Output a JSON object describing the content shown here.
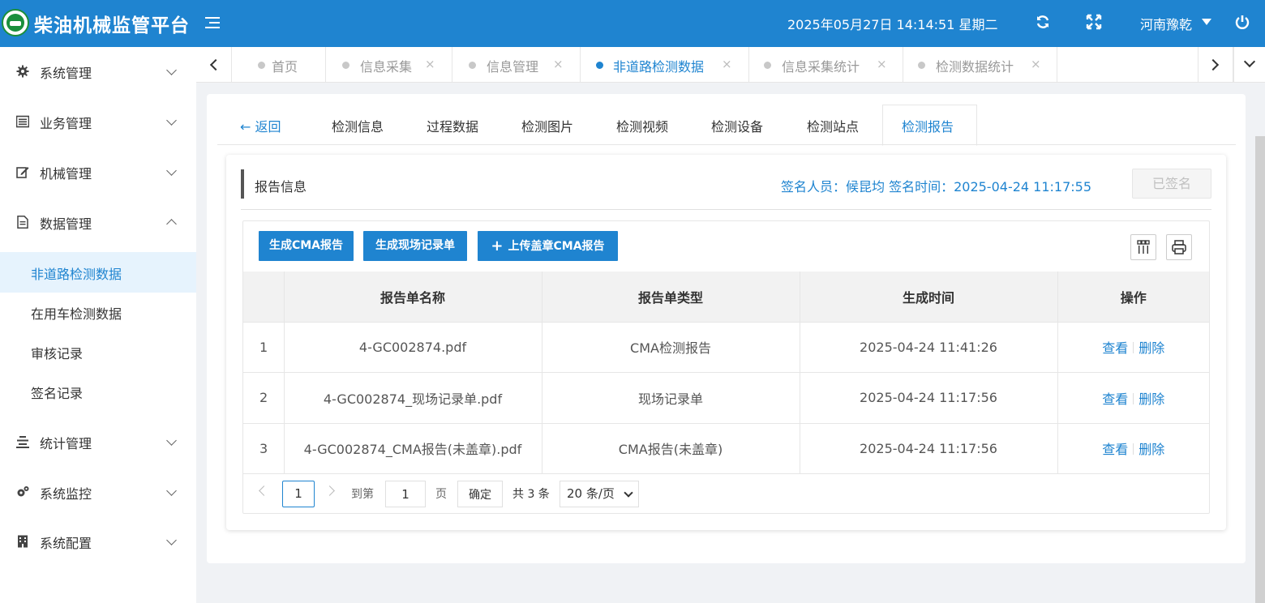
{
  "header": {
    "title": "柴油机械监管平台",
    "datetime": "2025年05月27日 14:14:51 星期二",
    "user": "河南豫乾"
  },
  "sidebar": {
    "menus": [
      {
        "label": "系统管理",
        "icon": "gear-icon"
      },
      {
        "label": "业务管理",
        "icon": "list-icon"
      },
      {
        "label": "机械管理",
        "icon": "edit-icon"
      },
      {
        "label": "数据管理",
        "icon": "document-icon"
      },
      {
        "label": "统计管理",
        "icon": "bars-icon"
      },
      {
        "label": "系统监控",
        "icon": "gears-icon"
      },
      {
        "label": "系统配置",
        "icon": "building-icon"
      }
    ],
    "data_submenu": [
      "非道路检测数据",
      "在用车检测数据",
      "审核记录",
      "签名记录"
    ]
  },
  "tabs": [
    "首页",
    "信息采集",
    "信息管理",
    "非道路检测数据",
    "信息采集统计",
    "检测数据统计"
  ],
  "subtabs": {
    "back": "← 返回",
    "items": [
      "检测信息",
      "过程数据",
      "检测图片",
      "检测视频",
      "检测设备",
      "检测站点",
      "检测报告"
    ]
  },
  "report": {
    "section_title": "报告信息",
    "signer": "签名人员：候昆均  签名时间：2025-04-24 11:17:55",
    "signed_label": "已签名",
    "buttons": {
      "gen_cma": "生成CMA报告",
      "gen_record": "生成现场记录单",
      "upload": "上传盖章CMA报告"
    },
    "columns": [
      "",
      "报告单名称",
      "报告单类型",
      "生成时间",
      "操作"
    ],
    "rows": [
      {
        "idx": "1",
        "name": "4-GC002874.pdf",
        "type": "CMA检测报告",
        "time": "2025-04-24 11:41:26"
      },
      {
        "idx": "2",
        "name": "4-GC002874_现场记录单.pdf",
        "type": "现场记录单",
        "time": "2025-04-24 11:17:56"
      },
      {
        "idx": "3",
        "name": "4-GC002874_CMA报告(未盖章).pdf",
        "type": "CMA报告(未盖章)",
        "time": "2025-04-24 11:17:56"
      }
    ],
    "ops": {
      "view": "查看",
      "delete": "删除"
    }
  },
  "pagination": {
    "current": "1",
    "goto_label": "到第",
    "goto_value": "1",
    "page_label": "页",
    "confirm": "确定",
    "total": "共 3 条",
    "page_size": "20 条/页"
  }
}
